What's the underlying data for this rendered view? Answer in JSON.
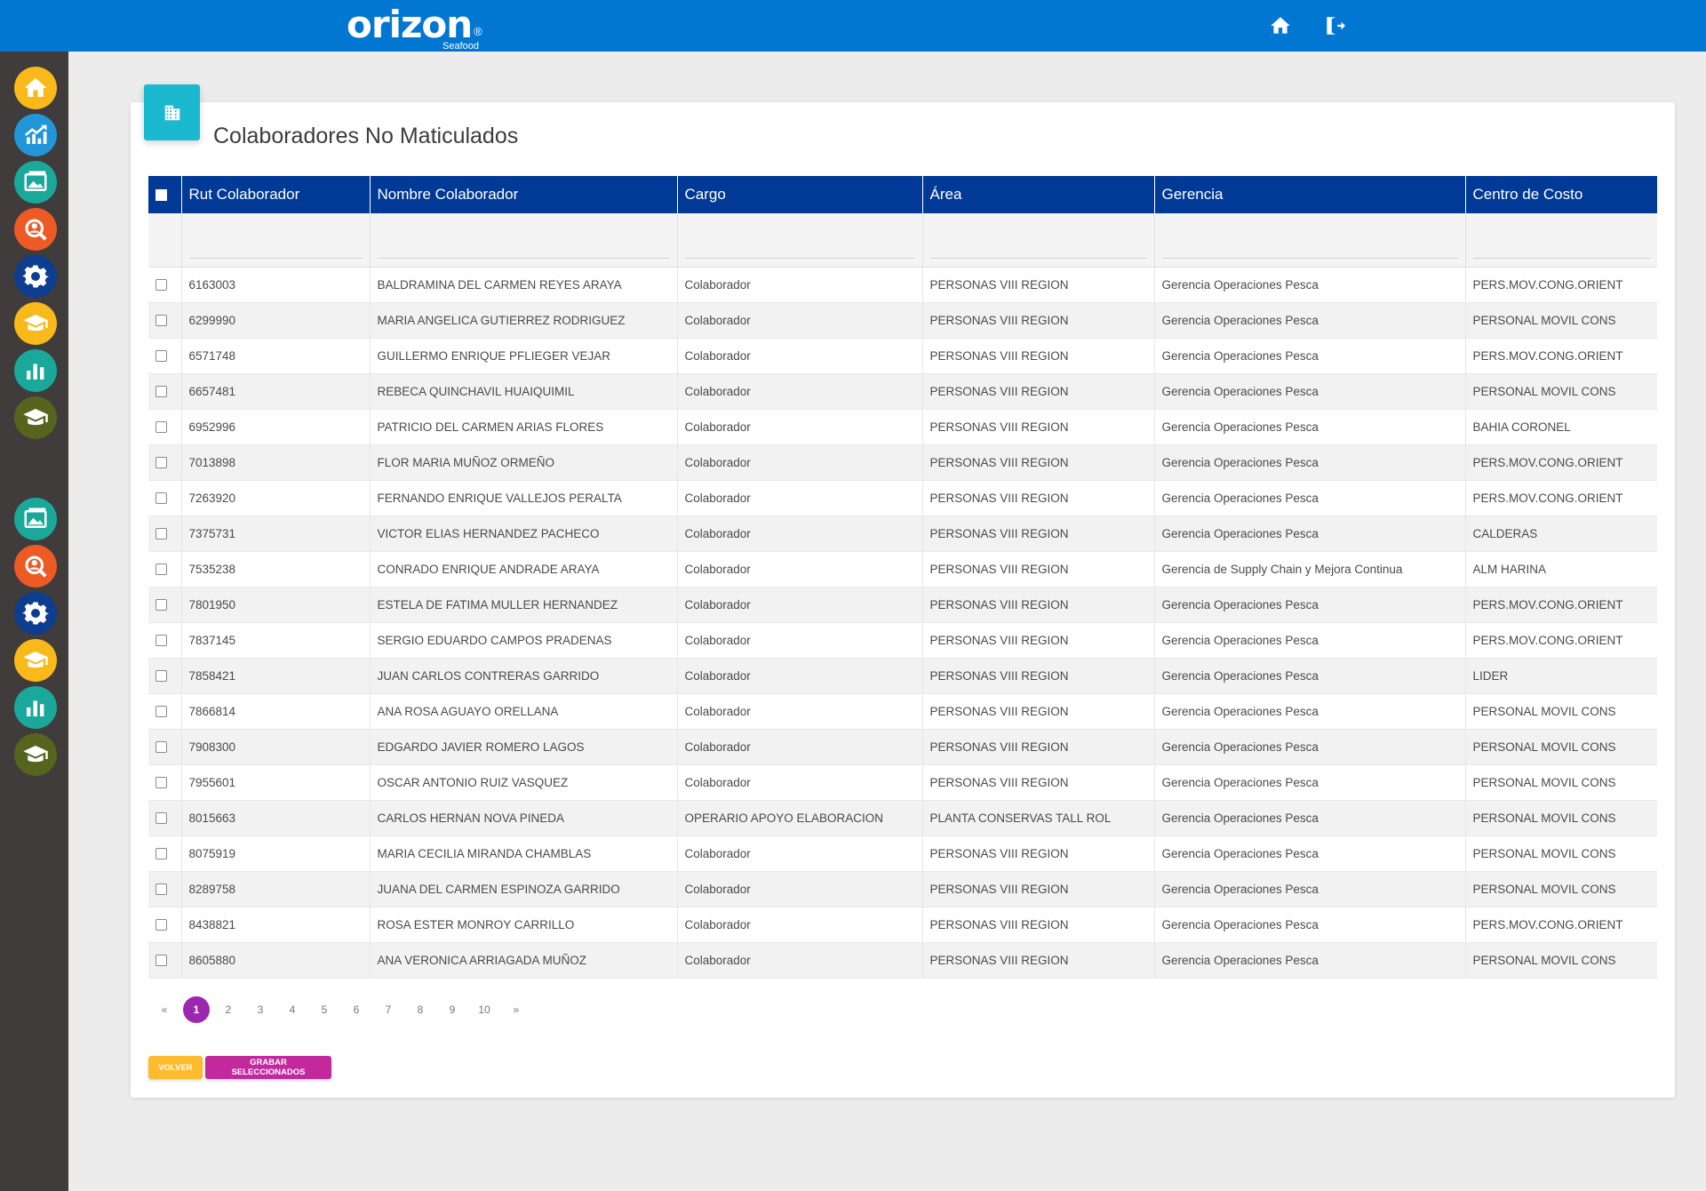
{
  "header": {
    "brand": "orizon",
    "brand_sub": "Seafood",
    "brand_reg": "®"
  },
  "sidebar": {
    "items": [
      {
        "icon": "home-icon",
        "color": "#f9b91a"
      },
      {
        "icon": "growth-chart-icon",
        "color": "#2196d8"
      },
      {
        "icon": "picture-icon",
        "color": "#1aa89a"
      },
      {
        "icon": "user-search-icon",
        "color": "#ee5a24"
      },
      {
        "icon": "gear-icon",
        "color": "#0d3d8f"
      },
      {
        "icon": "graduation-cap-icon",
        "color": "#f9b91a"
      },
      {
        "icon": "bar-chart-icon",
        "color": "#1aa89a"
      },
      {
        "icon": "graduation-cap-icon",
        "color": "#56641e"
      },
      {
        "icon": "picture-icon",
        "color": "#1aa89a"
      },
      {
        "icon": "user-search-icon",
        "color": "#ee5a24"
      },
      {
        "icon": "gear-icon",
        "color": "#0d3d8f"
      },
      {
        "icon": "graduation-cap-icon",
        "color": "#f9b91a"
      },
      {
        "icon": "bar-chart-icon",
        "color": "#1aa89a"
      },
      {
        "icon": "graduation-cap-icon",
        "color": "#56641e"
      }
    ]
  },
  "page": {
    "title": "Colaboradores No Maticulados"
  },
  "table": {
    "columns": [
      "Rut Colaborador",
      "Nombre Colaborador",
      "Cargo",
      "Área",
      "Gerencia",
      "Centro de Costo"
    ],
    "rows": [
      [
        "6163003",
        "BALDRAMINA DEL CARMEN REYES ARAYA",
        "Colaborador",
        "PERSONAS VIII REGION",
        "Gerencia Operaciones Pesca",
        "PERS.MOV.CONG.ORIENT"
      ],
      [
        "6299990",
        "MARIA ANGELICA GUTIERREZ RODRIGUEZ",
        "Colaborador",
        "PERSONAS VIII REGION",
        "Gerencia Operaciones Pesca",
        "PERSONAL MOVIL CONS"
      ],
      [
        "6571748",
        "GUILLERMO ENRIQUE PFLIEGER VEJAR",
        "Colaborador",
        "PERSONAS VIII REGION",
        "Gerencia Operaciones Pesca",
        "PERS.MOV.CONG.ORIENT"
      ],
      [
        "6657481",
        "REBECA QUINCHAVIL HUAIQUIMIL",
        "Colaborador",
        "PERSONAS VIII REGION",
        "Gerencia Operaciones Pesca",
        "PERSONAL MOVIL CONS"
      ],
      [
        "6952996",
        "PATRICIO DEL CARMEN ARIAS FLORES",
        "Colaborador",
        "PERSONAS VIII REGION",
        "Gerencia Operaciones Pesca",
        "BAHIA CORONEL"
      ],
      [
        "7013898",
        "FLOR MARIA MUÑOZ ORMEÑO",
        "Colaborador",
        "PERSONAS VIII REGION",
        "Gerencia Operaciones Pesca",
        "PERS.MOV.CONG.ORIENT"
      ],
      [
        "7263920",
        "FERNANDO ENRIQUE VALLEJOS PERALTA",
        "Colaborador",
        "PERSONAS VIII REGION",
        "Gerencia Operaciones Pesca",
        "PERS.MOV.CONG.ORIENT"
      ],
      [
        "7375731",
        "VICTOR ELIAS HERNANDEZ PACHECO",
        "Colaborador",
        "PERSONAS VIII REGION",
        "Gerencia Operaciones Pesca",
        "CALDERAS"
      ],
      [
        "7535238",
        "CONRADO ENRIQUE ANDRADE ARAYA",
        "Colaborador",
        "PERSONAS VIII REGION",
        "Gerencia de Supply Chain y Mejora Continua",
        "ALM HARINA"
      ],
      [
        "7801950",
        "ESTELA DE FATIMA MULLER HERNANDEZ",
        "Colaborador",
        "PERSONAS VIII REGION",
        "Gerencia Operaciones Pesca",
        "PERS.MOV.CONG.ORIENT"
      ],
      [
        "7837145",
        "SERGIO EDUARDO CAMPOS PRADENAS",
        "Colaborador",
        "PERSONAS VIII REGION",
        "Gerencia Operaciones Pesca",
        "PERS.MOV.CONG.ORIENT"
      ],
      [
        "7858421",
        "JUAN CARLOS CONTRERAS GARRIDO",
        "Colaborador",
        "PERSONAS VIII REGION",
        "Gerencia Operaciones Pesca",
        "LIDER"
      ],
      [
        "7866814",
        "ANA ROSA AGUAYO ORELLANA",
        "Colaborador",
        "PERSONAS VIII REGION",
        "Gerencia Operaciones Pesca",
        "PERSONAL MOVIL CONS"
      ],
      [
        "7908300",
        "EDGARDO JAVIER ROMERO LAGOS",
        "Colaborador",
        "PERSONAS VIII REGION",
        "Gerencia Operaciones Pesca",
        "PERSONAL MOVIL CONS"
      ],
      [
        "7955601",
        "OSCAR ANTONIO RUIZ VASQUEZ",
        "Colaborador",
        "PERSONAS VIII REGION",
        "Gerencia Operaciones Pesca",
        "PERSONAL MOVIL CONS"
      ],
      [
        "8015663",
        "CARLOS HERNAN NOVA PINEDA",
        "OPERARIO APOYO ELABORACION",
        "PLANTA CONSERVAS TALL ROL",
        "Gerencia Operaciones Pesca",
        "PERSONAL MOVIL CONS"
      ],
      [
        "8075919",
        "MARIA CECILIA MIRANDA CHAMBLAS",
        "Colaborador",
        "PERSONAS VIII REGION",
        "Gerencia Operaciones Pesca",
        "PERSONAL MOVIL CONS"
      ],
      [
        "8289758",
        "JUANA DEL CARMEN ESPINOZA GARRIDO",
        "Colaborador",
        "PERSONAS VIII REGION",
        "Gerencia Operaciones Pesca",
        "PERSONAL MOVIL CONS"
      ],
      [
        "8438821",
        "ROSA ESTER MONROY CARRILLO",
        "Colaborador",
        "PERSONAS VIII REGION",
        "Gerencia Operaciones Pesca",
        "PERS.MOV.CONG.ORIENT"
      ],
      [
        "8605880",
        "ANA VERONICA ARRIAGADA MUÑOZ",
        "Colaborador",
        "PERSONAS VIII REGION",
        "Gerencia Operaciones Pesca",
        "PERSONAL MOVIL CONS"
      ]
    ]
  },
  "pagination": {
    "prev": "«",
    "next": "»",
    "pages": [
      "1",
      "2",
      "3",
      "4",
      "5",
      "6",
      "7",
      "8",
      "9",
      "10"
    ],
    "current": "1"
  },
  "actions": {
    "back_label": "VOLVER",
    "save_label": "GRABAR SELECCIONADOS"
  },
  "colors": {
    "topbar": "#0277d1",
    "table_header": "#003a96",
    "sidebar": "#3f3c3b",
    "card_icon": "#1ab9d0",
    "page_active": "#9c27b0",
    "btn_back": "#fdbb2d",
    "btn_save": "#c2299d"
  }
}
